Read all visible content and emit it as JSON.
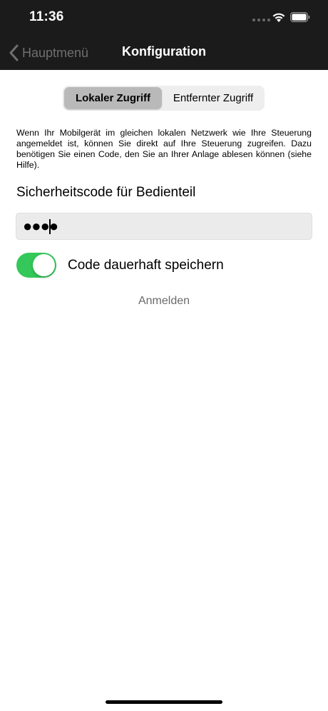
{
  "status_bar": {
    "time": "11:36"
  },
  "nav": {
    "back_label": "Hauptmenü",
    "title": "Konfiguration"
  },
  "segmented_control": {
    "options": [
      {
        "label": "Lokaler Zugriff",
        "selected": true
      },
      {
        "label": "Entfernter Zugriff",
        "selected": false
      }
    ]
  },
  "info_text": "Wenn Ihr Mobilgerät im gleichen lokalen Netzwerk wie Ihre Steuerung angemeldet ist, können Sie direkt auf Ihre Steuerung zugreifen. Dazu benötigen Sie einen Code, den Sie an Ihrer Anlage ablesen können (siehe Hilfe).",
  "security_code": {
    "label": "Sicherheitscode für Bedienteil",
    "value": "●●●●"
  },
  "save_toggle": {
    "label": "Code dauerhaft speichern",
    "on": true
  },
  "login_label": "Anmelden",
  "colors": {
    "header_bg": "#1b1b1b",
    "toggle_on": "#34c759",
    "back_text": "#6f6f6f"
  },
  "icons": {
    "wifi": "wifi-icon",
    "battery": "battery-icon",
    "back": "chevron-left-icon",
    "signal": "cellular-signal-icon"
  }
}
